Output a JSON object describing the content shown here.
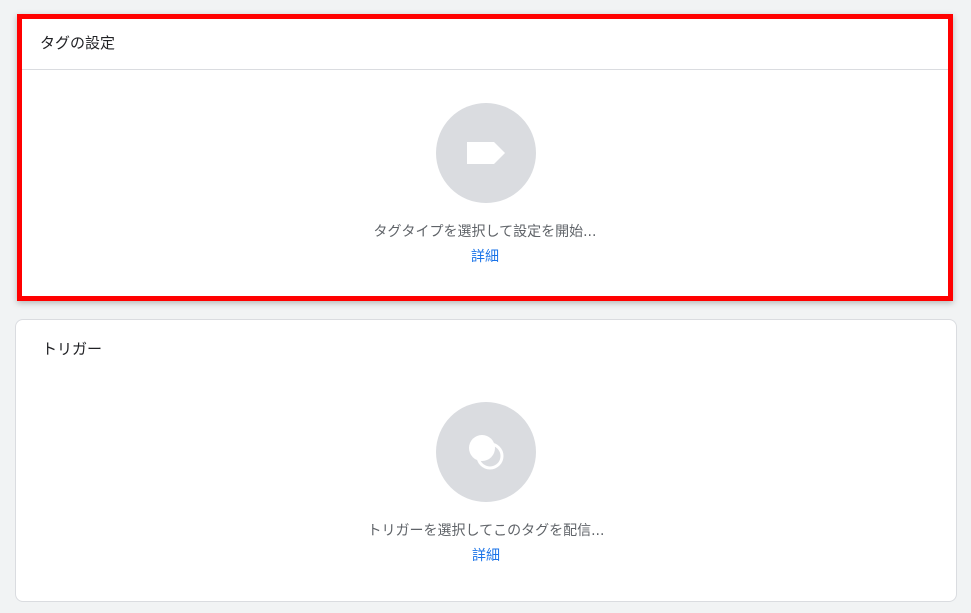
{
  "tag_config": {
    "title": "タグの設定",
    "hint": "タグタイプを選択して設定を開始...",
    "link": "詳細",
    "icon": "tag-icon"
  },
  "trigger": {
    "title": "トリガー",
    "hint": "トリガーを選択してこのタグを配信...",
    "link": "詳細",
    "icon": "trigger-icon"
  },
  "colors": {
    "highlight_border": "#ff0000",
    "link": "#1a73e8",
    "icon_circle": "#dadce0",
    "background": "#f1f3f4"
  }
}
